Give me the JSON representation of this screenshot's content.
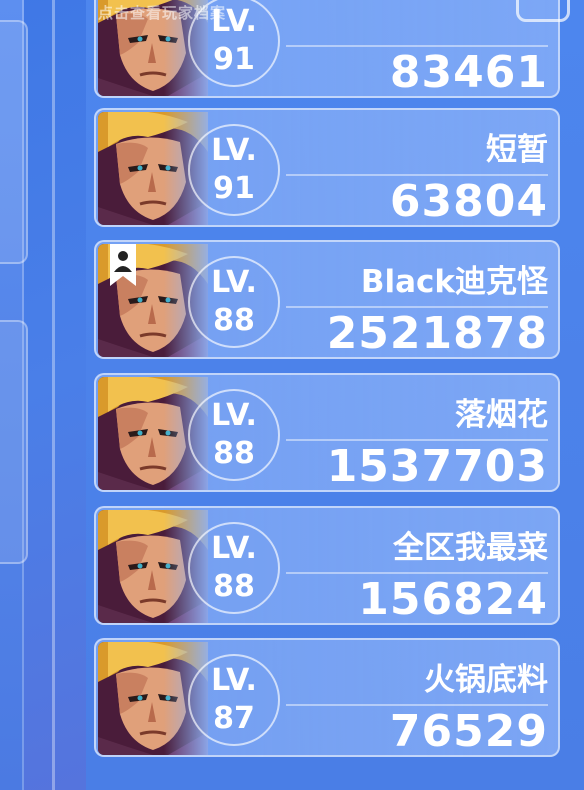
{
  "hint_text": "点击查看玩家档案",
  "players": [
    {
      "level_label": "LV.",
      "level": "91",
      "name": "",
      "score": "83461",
      "badge": false
    },
    {
      "level_label": "LV.",
      "level": "91",
      "name": "短暂",
      "score": "63804",
      "badge": false
    },
    {
      "level_label": "LV.",
      "level": "88",
      "name": "Black迪克怪",
      "score": "2521878",
      "badge": true
    },
    {
      "level_label": "LV.",
      "level": "88",
      "name": "落烟花",
      "score": "1537703",
      "badge": false
    },
    {
      "level_label": "LV.",
      "level": "88",
      "name": "全区我最菜",
      "score": "156824",
      "badge": false
    },
    {
      "level_label": "LV.",
      "level": "87",
      "name": "火锅底料",
      "score": "76529",
      "badge": false
    }
  ],
  "colors": {
    "background": "#4a7fe8",
    "card": "#8fb2f6",
    "text": "#ffffff"
  },
  "icons": {
    "avatar": "hero-portrait-icon",
    "badge": "user-badge-icon"
  }
}
